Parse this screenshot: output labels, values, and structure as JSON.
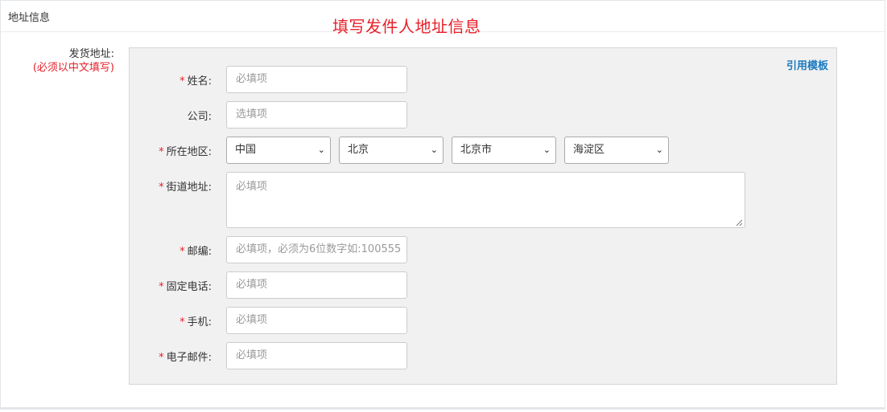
{
  "panel": {
    "title": "地址信息"
  },
  "annotation": "填写发件人地址信息",
  "side": {
    "label": "发货地址:",
    "note": "(必须以中文填写)"
  },
  "template_link": "引用模板",
  "required_mark": "*",
  "fields": {
    "name": {
      "label": "姓名:",
      "placeholder": "必填项"
    },
    "company": {
      "label": "公司:",
      "placeholder": "选填项"
    },
    "region": {
      "label": "所在地区:",
      "country": "中国",
      "province": "北京",
      "city": "北京市",
      "district": "海淀区"
    },
    "street": {
      "label": "街道地址:",
      "placeholder": "必填项"
    },
    "postcode": {
      "label": "邮编:",
      "placeholder": "必填项，必须为6位数字如:100555"
    },
    "phone": {
      "label": "固定电话:",
      "placeholder": "必填项"
    },
    "mobile": {
      "label": "手机:",
      "placeholder": "必填项"
    },
    "email": {
      "label": "电子邮件:",
      "placeholder": "必填项"
    }
  },
  "icons": {
    "select_arrow": "chevron-down-icon",
    "resize": "resize-grip-icon"
  }
}
